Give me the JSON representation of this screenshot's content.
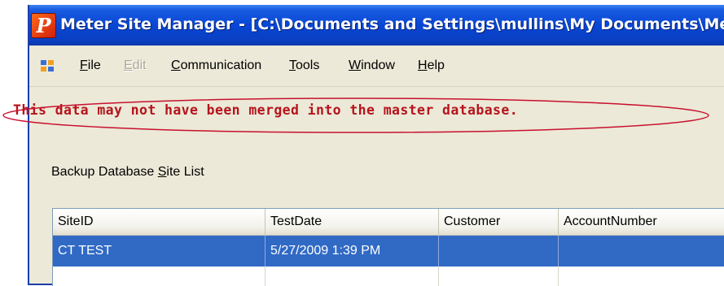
{
  "window": {
    "title": "Meter Site Manager - [C:\\Documents and Settings\\mullins\\My Documents\\Meter Site Manager\\Backup",
    "app_icon_letter": "P"
  },
  "menu": {
    "items": [
      {
        "key": "file",
        "pre": "",
        "accel": "F",
        "post": "ile",
        "disabled": false
      },
      {
        "key": "edit",
        "pre": "",
        "accel": "E",
        "post": "dit",
        "disabled": true
      },
      {
        "key": "communication",
        "pre": "",
        "accel": "C",
        "post": "ommunication",
        "disabled": false
      },
      {
        "key": "tools",
        "pre": "",
        "accel": "T",
        "post": "ools",
        "disabled": false
      },
      {
        "key": "window",
        "pre": "",
        "accel": "W",
        "post": "indow",
        "disabled": false
      },
      {
        "key": "help",
        "pre": "",
        "accel": "H",
        "post": "elp",
        "disabled": false
      }
    ]
  },
  "warning": {
    "text": "This data may not have been merged into the master database.",
    "color": "#b5141d"
  },
  "site_list": {
    "label_pre": "Backup Database ",
    "label_accel": "S",
    "label_post": "ite List",
    "columns": [
      "SiteID",
      "TestDate",
      "Customer",
      "AccountNumber"
    ],
    "rows": [
      {
        "selected": true,
        "cells": [
          "CT TEST",
          "5/27/2009 1:39 PM",
          "",
          ""
        ]
      },
      {
        "selected": false,
        "cells": [
          "",
          "",
          "",
          ""
        ]
      }
    ]
  },
  "colors": {
    "titlebar": "#0846d5",
    "selection": "#316ac5",
    "annotation": "#c8102e"
  }
}
